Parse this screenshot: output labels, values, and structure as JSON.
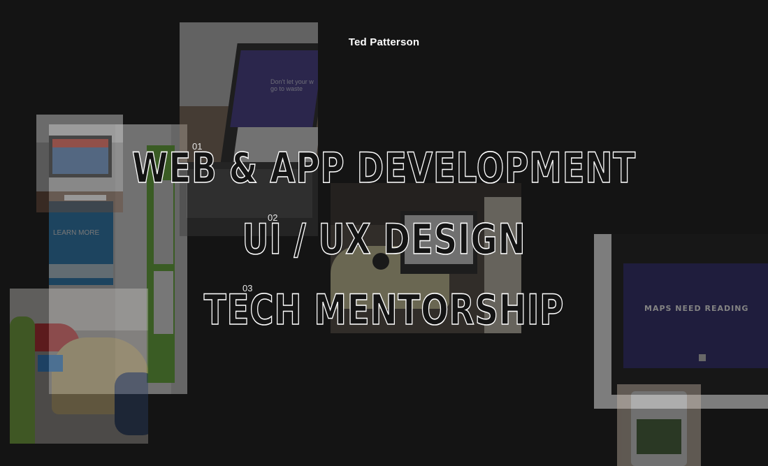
{
  "header": {
    "name": "Ted Patterson"
  },
  "services": [
    {
      "number": "01",
      "label": "WEB & APP DEVELOPMENT"
    },
    {
      "number": "02",
      "label": "UI / UX DESIGN"
    },
    {
      "number": "03",
      "label": "TECH MENTORSHIP"
    }
  ],
  "photos": {
    "kiosk_screen": {
      "button_text": "LEARN MORE"
    },
    "laptop": {
      "headline": "Don't let your w go to waste"
    },
    "maps": {
      "title": "MAPS NEED READING"
    }
  },
  "colors": {
    "background": "#141414",
    "text": "#ffffff"
  }
}
